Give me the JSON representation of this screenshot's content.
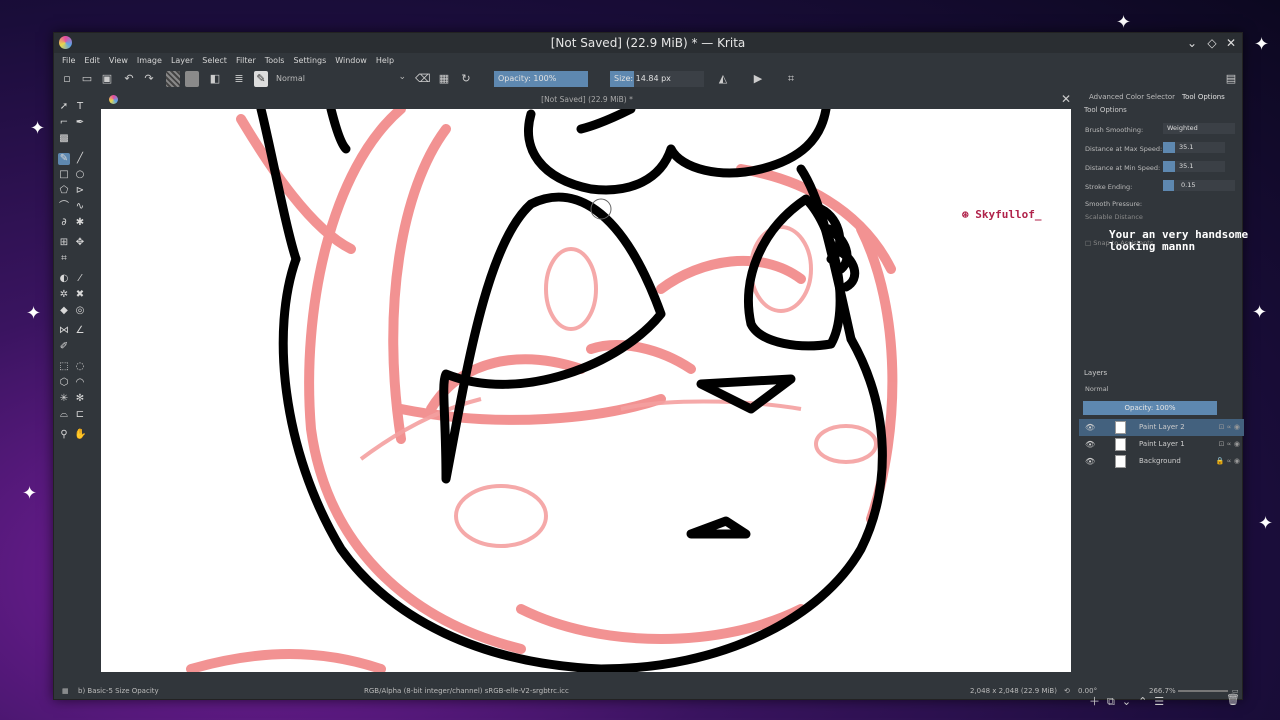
{
  "window": {
    "title": "[Not Saved] (22.9 MiB) * — Krita",
    "controls": [
      "⌄",
      "◇",
      "✕"
    ]
  },
  "menu": [
    "File",
    "Edit",
    "View",
    "Image",
    "Layer",
    "Select",
    "Filter",
    "Tools",
    "Settings",
    "Window",
    "Help"
  ],
  "toolbar": {
    "blend_mode": "Normal",
    "opacity_label": "Opacity: 100%",
    "opacity": 1.0,
    "size_label": "Size: 14.84 px",
    "size_fraction": 0.25
  },
  "document_tab": {
    "title": "[Not Saved]  (22.9 MiB) *"
  },
  "dockers": {
    "tabs": [
      "Advanced Color Selector",
      "Tool Options"
    ],
    "tool_options": {
      "header": "Tool Options",
      "brush_smoothing_label": "Brush Smoothing:",
      "brush_smoothing_value": "Weighted",
      "rows": [
        {
          "label": "Distance at Max Speed:",
          "value": "35.1",
          "fill": 0.2
        },
        {
          "label": "Distance at Min Speed:",
          "value": "35.1",
          "fill": 0.2
        },
        {
          "label": "Stroke Ending:",
          "value": "0.15",
          "fill": 0.15
        }
      ],
      "smooth_pressure_label": "Smooth Pressure:",
      "scalable_distance_label": "Scalable Distance",
      "snap_label": "Snap to Assistants"
    },
    "layers": {
      "header": "Layers",
      "blend_mode": "Normal",
      "opacity_label": "Opacity: 100%",
      "items": [
        {
          "name": "Paint Layer 2",
          "active": true
        },
        {
          "name": "Paint Layer 1",
          "active": false
        },
        {
          "name": "Background",
          "active": false
        }
      ]
    }
  },
  "chat": {
    "user": "Skyfullof_",
    "message": "Your an very handsome looking mannn"
  },
  "statusbar": {
    "brush": "b) Basic-5 Size Opacity",
    "color_profile": "RGB/Alpha (8-bit integer/channel)  sRGB-elle-V2-srgbtrc.icc",
    "dimensions": "2,048 x 2,048 (22.9 MiB)",
    "rotation": "0.00°",
    "zoom": "266.7%"
  },
  "colors": {
    "accent": "#5e88b0",
    "sketch_red": "#f08080",
    "ink": "#000000"
  }
}
